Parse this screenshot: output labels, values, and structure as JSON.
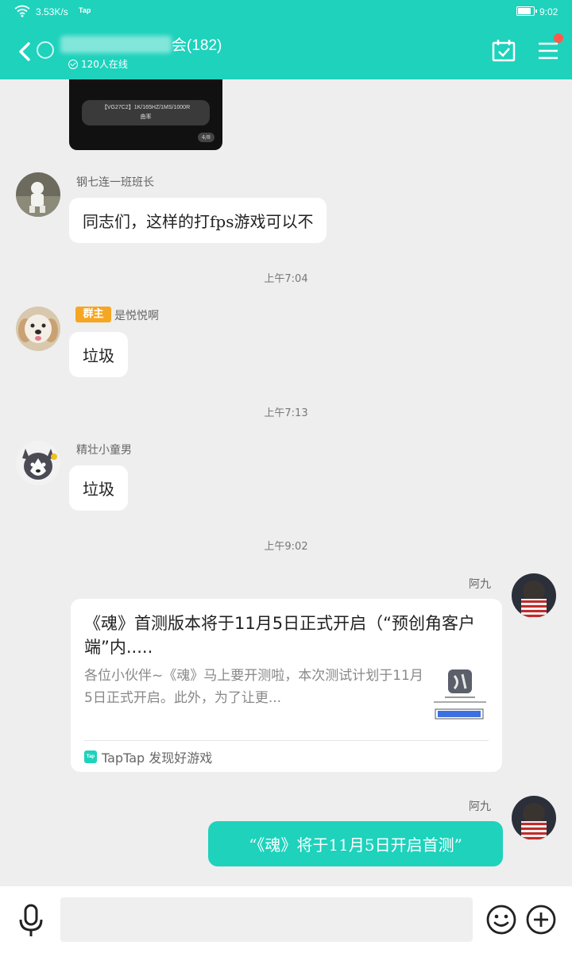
{
  "status_bar": {
    "network_speed": "3.53K/s",
    "app_badge": "Tap",
    "time": "9:02",
    "battery_level": 0.75
  },
  "header": {
    "title": "会(182)",
    "online_text": "120人在线",
    "accent_color": "#1ed2bc",
    "notification_dot_color": "#ff5a4b"
  },
  "messages": {
    "image_message": {
      "caption": "【VG27C2】1K/165HZ/1MS/1000R",
      "caption2": "曲率",
      "page": "4/8"
    },
    "msg1": {
      "sender": "钢七连一班班长",
      "text": "同志们，这样的打fps游戏可以不"
    },
    "time1": "上午7:04",
    "msg2": {
      "badge": "群主",
      "sender": "是悦悦啊",
      "text": "垃圾"
    },
    "time2": "上午7:13",
    "msg3": {
      "sender": "精壮小童男",
      "text": "垃圾"
    },
    "time3": "上午9:02",
    "msg4": {
      "sender": "阿九",
      "card": {
        "title": "《魂》首测版本将于11月5日正式开启（“预创角客户端”内.....",
        "description": "各位小伙伴~《魂》马上要开测啦，本次测试计划于11月5日正式开启。此外，为了让更...",
        "source_icon": "Tap",
        "source": "TapTap 发现好游戏"
      }
    },
    "msg5": {
      "sender": "阿九",
      "text": "“《魂》将于11月5日开启首测”"
    }
  },
  "input_bar": {
    "placeholder": "",
    "icons": [
      "microphone-icon",
      "emoji-icon",
      "plus-icon"
    ]
  }
}
